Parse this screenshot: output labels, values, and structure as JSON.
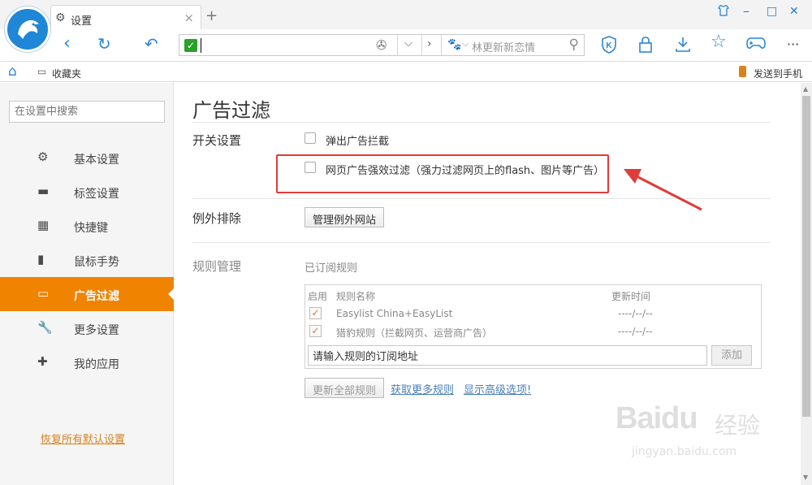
{
  "tab": {
    "title": "设置",
    "close": "×",
    "new_tab": "+"
  },
  "window_controls": [
    "⬚",
    "–",
    "□",
    "✕"
  ],
  "address_bar": {
    "url": "",
    "search_hint": "林更新新恋情"
  },
  "bookmarks_bar": {
    "favorites_label": "收藏夹",
    "send_to_phone_label": "发送到手机"
  },
  "sidebar": {
    "search_placeholder": "在设置中搜索",
    "items": [
      {
        "label": "基本设置",
        "icon": "gear-icon"
      },
      {
        "label": "标签设置",
        "icon": "tab-icon"
      },
      {
        "label": "快捷键",
        "icon": "keyboard-icon"
      },
      {
        "label": "鼠标手势",
        "icon": "mouse-icon"
      },
      {
        "label": "广告过滤",
        "icon": "window-icon",
        "active": true
      },
      {
        "label": "更多设置",
        "icon": "wrench-icon"
      },
      {
        "label": "我的应用",
        "icon": "puzzle-icon"
      }
    ],
    "restore_label": "恢复所有默认设置"
  },
  "main": {
    "title": "广告过滤",
    "switch_section": {
      "label": "开关设置",
      "popup_block_label": "弹出广告拦截",
      "popup_block_checked": false,
      "strong_filter_label": "网页广告强效过滤（强力过滤网页上的flash、图片等广告）",
      "strong_filter_checked": false
    },
    "exceptions_section": {
      "label": "例外排除",
      "manage_button": "管理例外网站"
    },
    "rules_section": {
      "label": "规则管理",
      "subscribed_label": "已订阅规则",
      "columns": {
        "enabled": "启用",
        "name": "规则名称",
        "updated": "更新时间"
      },
      "rows": [
        {
          "enabled": true,
          "name": "Easylist China+EasyList",
          "updated": "----/--/--"
        },
        {
          "enabled": true,
          "name": "猎豹规则（拦截网页、运营商广告）",
          "updated": "----/--/--"
        }
      ],
      "subscribe_input_value": "请输入规则的订阅地址",
      "add_button": "添加",
      "update_all_button": "更新全部规则",
      "more_rules_link": "获取更多规则",
      "advanced_link": "显示高级选项!"
    }
  },
  "watermark": {
    "brand": "Baidu",
    "cn": "经验",
    "url": "jingyan.baidu.com"
  },
  "colors": {
    "accent": "#f08300",
    "brand_blue": "#2a86d8",
    "highlight_red": "#e23a3a"
  }
}
